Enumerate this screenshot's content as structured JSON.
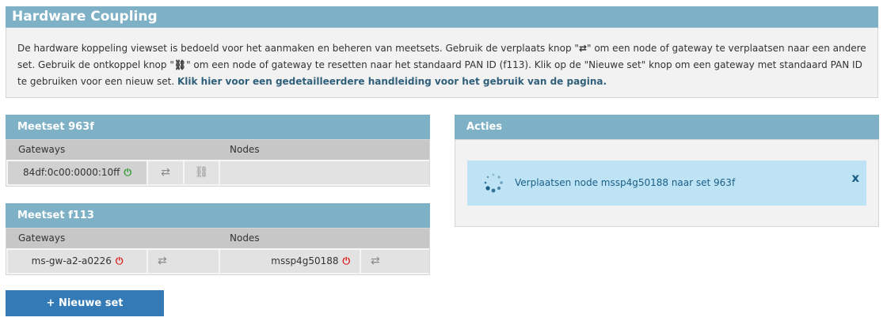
{
  "header": {
    "title": "Hardware Coupling"
  },
  "intro": {
    "text_1": "De hardware koppeling viewset is bedoeld voor het aanmaken en beheren van meetsets. Gebruik de verplaats knop \"",
    "move_glyph": "⇄",
    "text_2": "\" om een node of gateway te verplaatsen naar een andere set. Gebruik de ontkoppel knop \"",
    "unlink_glyph": "⛓",
    "text_3": "\" om een node of gateway te resetten naar het standaard PAN ID (f113). Klik op de \"Nieuwe set\" knop om een gateway met standaard PAN ID te gebruiken voor een nieuw set. ",
    "link": "Klik hier voor een gedetailleerdere handleiding voor het gebruik van de pagina."
  },
  "sets": [
    {
      "title": "Meetset 963f",
      "col_gateways": "Gateways",
      "col_nodes": "Nodes",
      "gateway": {
        "id": "84df:0c00:0000:10ff",
        "status": "online",
        "power_color": "#2e9a2e"
      }
    },
    {
      "title": "Meetset f113",
      "col_gateways": "Gateways",
      "col_nodes": "Nodes",
      "gateway": {
        "id": "ms-gw-a2-a0226",
        "status": "offline",
        "power_color": "#e02020"
      },
      "node": {
        "id": "mssp4g50188",
        "status": "offline",
        "power_color": "#e02020"
      }
    }
  ],
  "actions": {
    "title": "Acties",
    "alert_text": "Verplaatsen node mssp4g50188 naar set 963f",
    "close_label": "x"
  },
  "icons": {
    "power": "⏻",
    "move": "⇄",
    "unlink": "⛓",
    "plus": "+"
  },
  "buttons": {
    "new_set": "Nieuwe set"
  }
}
